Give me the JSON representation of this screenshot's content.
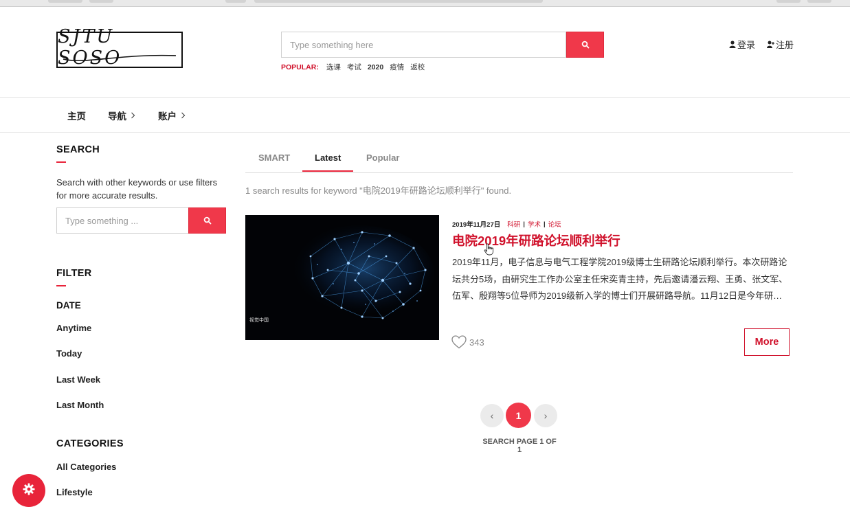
{
  "header": {
    "logo_text": "SJTU SOSO",
    "search_placeholder": "Type something here",
    "popular_label": "POPULAR:",
    "popular_keywords": [
      "选课",
      "考试",
      "2020",
      "疫情",
      "返校"
    ],
    "login_label": "登录",
    "register_label": "注册"
  },
  "nav": {
    "items": [
      {
        "label": "主页",
        "has_submenu": false
      },
      {
        "label": "导航",
        "has_submenu": true
      },
      {
        "label": "账户",
        "has_submenu": true
      }
    ]
  },
  "sidebar": {
    "search_title": "SEARCH",
    "search_desc": "Search with other keywords or use filters for more accurate results.",
    "search_placeholder": "Type something ...",
    "filter_title": "FILTER",
    "date_title": "DATE",
    "date_options": [
      "Anytime",
      "Today",
      "Last Week",
      "Last Month"
    ],
    "categories_title": "CATEGORIES",
    "category_options": [
      "All Categories",
      "Lifestyle"
    ]
  },
  "results": {
    "tabs": [
      "SMART",
      "Latest",
      "Popular"
    ],
    "active_tab": "Latest",
    "count_text": "1 search results for keyword \"电院2019年研路论坛顺利举行\" found.",
    "items": [
      {
        "thumb_watermark": "视觉中国",
        "date": "2019年11月27日",
        "categories": [
          "科研",
          "学术",
          "论坛"
        ],
        "title": "电院2019年研路论坛顺利举行",
        "excerpt": "2019年11月，电子信息与电气工程学院2019级博士生研路论坛顺利举行。本次研路论坛共分5场，由研究生工作办公室主任宋奕青主持，先后邀请潘云翔、王勇、张文军、伍军、殷翔等5位导师为2019级新入学的博士们开展研路导航。11月12日是今年研…",
        "likes": "343",
        "more_label": "More"
      }
    ]
  },
  "pagination": {
    "prev": "‹",
    "current": "1",
    "next": "›",
    "info": "SEARCH PAGE 1 OF 1"
  },
  "colors": {
    "accent": "#f0384a",
    "title_red": "#d0112b",
    "border": "#cfcfcf"
  },
  "icons": {
    "search": "search-icon",
    "user": "user-icon",
    "user_plus": "user-plus-icon",
    "chevron": "chevron-right-icon",
    "heart": "heart-icon",
    "gear": "gear-icon"
  }
}
